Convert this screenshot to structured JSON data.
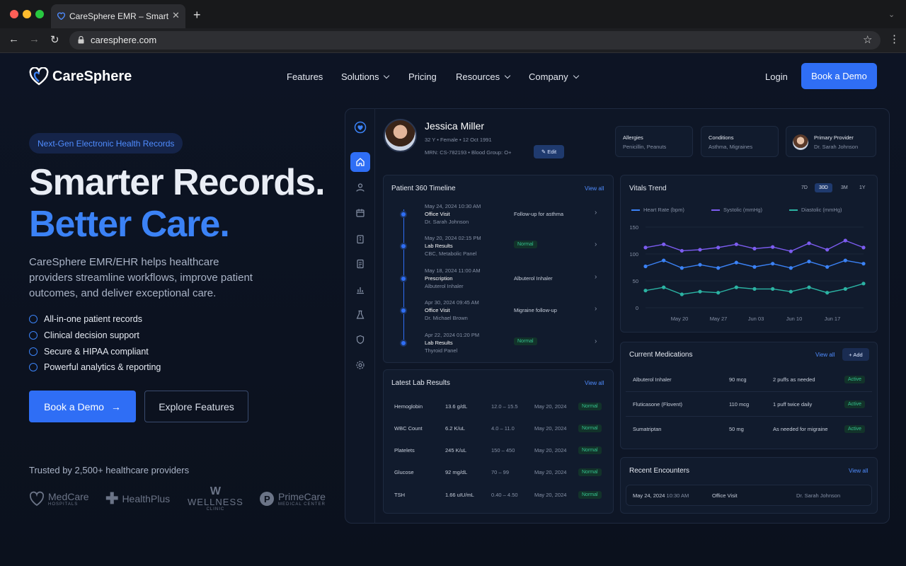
{
  "browser": {
    "tab_title": "CareSphere EMR – Smart EHR",
    "url": "caresphere.com"
  },
  "nav": {
    "brand": "CareSphere",
    "items": [
      "Features",
      "Solutions",
      "Pricing",
      "Resources",
      "Company"
    ],
    "login": "Login",
    "book_demo": "Book a Demo"
  },
  "hero": {
    "badge": "Next-Gen Electronic Health Records",
    "headline_1": "Smarter Records.",
    "headline_2": "Better Care.",
    "subtitle": "CareSphere EMR/EHR helps healthcare providers streamline workflows, improve patient outcomes, and deliver exceptional care.",
    "features": [
      "All-in-one patient records",
      "Clinical decision support",
      "Secure & HIPAA compliant",
      "Powerful analytics & reporting"
    ],
    "cta_primary": "Book a Demo",
    "cta_secondary": "Explore Features",
    "trusted": "Trusted by 2,500+ healthcare providers",
    "logos": [
      {
        "name": "MedCare",
        "sub": "HOSPITALS"
      },
      {
        "name": "HealthPlus",
        "sub": ""
      },
      {
        "name": "WELLNESS",
        "sub": "CLINIC"
      },
      {
        "name": "PrimeCare",
        "sub": "MEDICAL CENTER"
      }
    ]
  },
  "patient": {
    "name": "Jessica Miller",
    "demographics": "32 Y  •  Female  •  12 Oct 1991",
    "ids": "MRN: CS-782193  •  Blood Group: O+",
    "edit": "✎ Edit",
    "allergies_label": "Allergies",
    "allergies": "Penicillin, Peanuts",
    "conditions_label": "Conditions",
    "conditions": "Asthma, Migraines",
    "provider_label": "Primary Provider",
    "provider": "Dr. Sarah Johnson"
  },
  "timeline": {
    "title": "Patient 360 Timeline",
    "view_all": "View all",
    "items": [
      {
        "date": "May 24, 2024  10:30 AM",
        "type": "Office Visit",
        "who": "Dr. Sarah Johnson",
        "note": "Follow-up for asthma",
        "status": ""
      },
      {
        "date": "May 20, 2024  02:15 PM",
        "type": "Lab Results",
        "who": "CBC, Metabolic Panel",
        "note": "",
        "status": "Normal"
      },
      {
        "date": "May 18, 2024  11:00 AM",
        "type": "Prescription",
        "who": "Albuterol Inhaler",
        "note": "Albuterol Inhaler",
        "status": ""
      },
      {
        "date": "Apr 30, 2024  09:45 AM",
        "type": "Office Visit",
        "who": "Dr. Michael Brown",
        "note": "Migraine follow-up",
        "status": ""
      },
      {
        "date": "Apr 22, 2024  01:20 PM",
        "type": "Lab Results",
        "who": "Thyroid Panel",
        "note": "",
        "status": "Normal"
      }
    ]
  },
  "vitals": {
    "title": "Vitals Trend",
    "ranges": [
      "7D",
      "30D",
      "3M",
      "1Y"
    ],
    "active_range": "30D",
    "legend": [
      "Heart Rate (bpm)",
      "Systolic (mmHg)",
      "Diastolic (mmHg)"
    ],
    "colors": {
      "heart": "#3b82f6",
      "systolic": "#7c5cf0",
      "diastolic": "#2bb3a3"
    }
  },
  "chart_data": {
    "type": "line",
    "y_ticks": [
      "150",
      "100",
      "50",
      "0"
    ],
    "ylim": [
      0,
      150
    ],
    "x_ticks": [
      "May 20",
      "May 27",
      "Jun 03",
      "Jun 10",
      "Jun 17"
    ],
    "series": [
      {
        "name": "Systolic (mmHg)",
        "values": [
          112,
          118,
          106,
          108,
          112,
          118,
          110,
          113,
          105,
          120,
          108,
          125,
          112
        ]
      },
      {
        "name": "Heart Rate (bpm)",
        "values": [
          77,
          88,
          74,
          80,
          74,
          84,
          76,
          82,
          74,
          86,
          76,
          88,
          82
        ]
      },
      {
        "name": "Diastolic (mmHg)",
        "values": [
          32,
          38,
          25,
          30,
          28,
          38,
          35,
          35,
          30,
          38,
          28,
          35,
          45
        ]
      }
    ]
  },
  "labs": {
    "title": "Latest Lab Results",
    "view_all": "View all",
    "rows": [
      {
        "test": "Hemoglobin",
        "value": "13.6 g/dL",
        "range": "12.0 – 15.5",
        "date": "May 20, 2024",
        "status": "Normal"
      },
      {
        "test": "WBC Count",
        "value": "6.2 K/uL",
        "range": "4.0 – 11.0",
        "date": "May 20, 2024",
        "status": "Normal"
      },
      {
        "test": "Platelets",
        "value": "245 K/uL",
        "range": "150 – 450",
        "date": "May 20, 2024",
        "status": "Normal"
      },
      {
        "test": "Glucose",
        "value": "92 mg/dL",
        "range": "70 – 99",
        "date": "May 20, 2024",
        "status": "Normal"
      },
      {
        "test": "TSH",
        "value": "1.66 uIU/mL",
        "range": "0.40 – 4.50",
        "date": "May 20, 2024",
        "status": "Normal"
      }
    ]
  },
  "meds": {
    "title": "Current Medications",
    "view_all": "View all",
    "add": "+ Add",
    "rows": [
      {
        "name": "Albuterol Inhaler",
        "dose": "90 mcg",
        "freq": "2 puffs as needed",
        "status": "Active"
      },
      {
        "name": "Fluticasone (Flovent)",
        "dose": "110 mcg",
        "freq": "1 puff twice daily",
        "status": "Active"
      },
      {
        "name": "Sumatriptan",
        "dose": "50 mg",
        "freq": "As needed for migraine",
        "status": "Active"
      }
    ]
  },
  "encounters": {
    "title": "Recent Encounters",
    "view_all": "View all",
    "row": {
      "date": "May 24, 2024",
      "time": "10:30 AM",
      "type": "Office Visit",
      "provider": "Dr. Sarah Johnson"
    }
  }
}
